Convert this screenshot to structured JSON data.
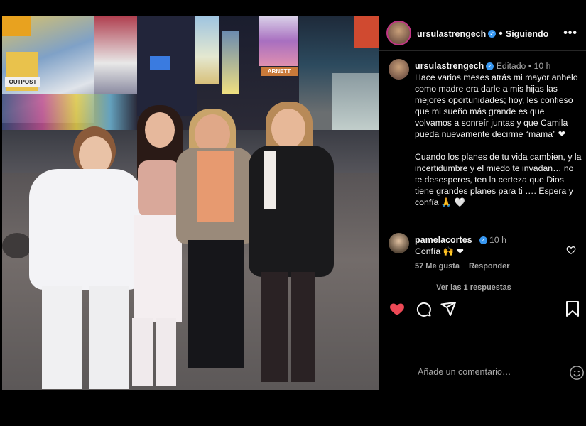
{
  "post": {
    "author": "ursulastrengech",
    "follow_status": "Siguiendo",
    "more_label": "•••",
    "caption": {
      "author": "ursulastrengech",
      "edited": "Editado",
      "time": "10 h",
      "text_p1": "Hace varios meses atrás mi mayor anhelo como madre era darle a mis hijas las mejores oportunidades; hoy, les confieso que mi sueño más grande es que volvamos a sonreír juntas y que Camila pueda nuevamente decirme “mama” ❤",
      "text_p2": "Cuando los planes de tu vida cambien, y la incertidumbre y el miedo te invadan… no te desesperes, ten la certeza que Dios tiene grandes planes para ti …. Espera y confía 🙏 🤍"
    },
    "comments": [
      {
        "author": "pamelacortes_",
        "time": "10 h",
        "text": "Confía 🙌 ❤",
        "likes": "57 Me gusta",
        "reply_label": "Responder",
        "view_replies": "Ver las 1 respuestas"
      }
    ],
    "add_comment_placeholder": "Añade un comentario…",
    "colors": {
      "like_red": "#ed4956",
      "verified_blue": "#3897f0",
      "ring": "#c13584"
    },
    "icons": [
      "heart-filled-icon",
      "comment-icon",
      "share-icon",
      "bookmark-icon",
      "emoji-icon",
      "heart-outline-icon",
      "verified-icon"
    ]
  },
  "signs": {
    "marquee": "ARNETT",
    "store": "OUTPOST"
  }
}
